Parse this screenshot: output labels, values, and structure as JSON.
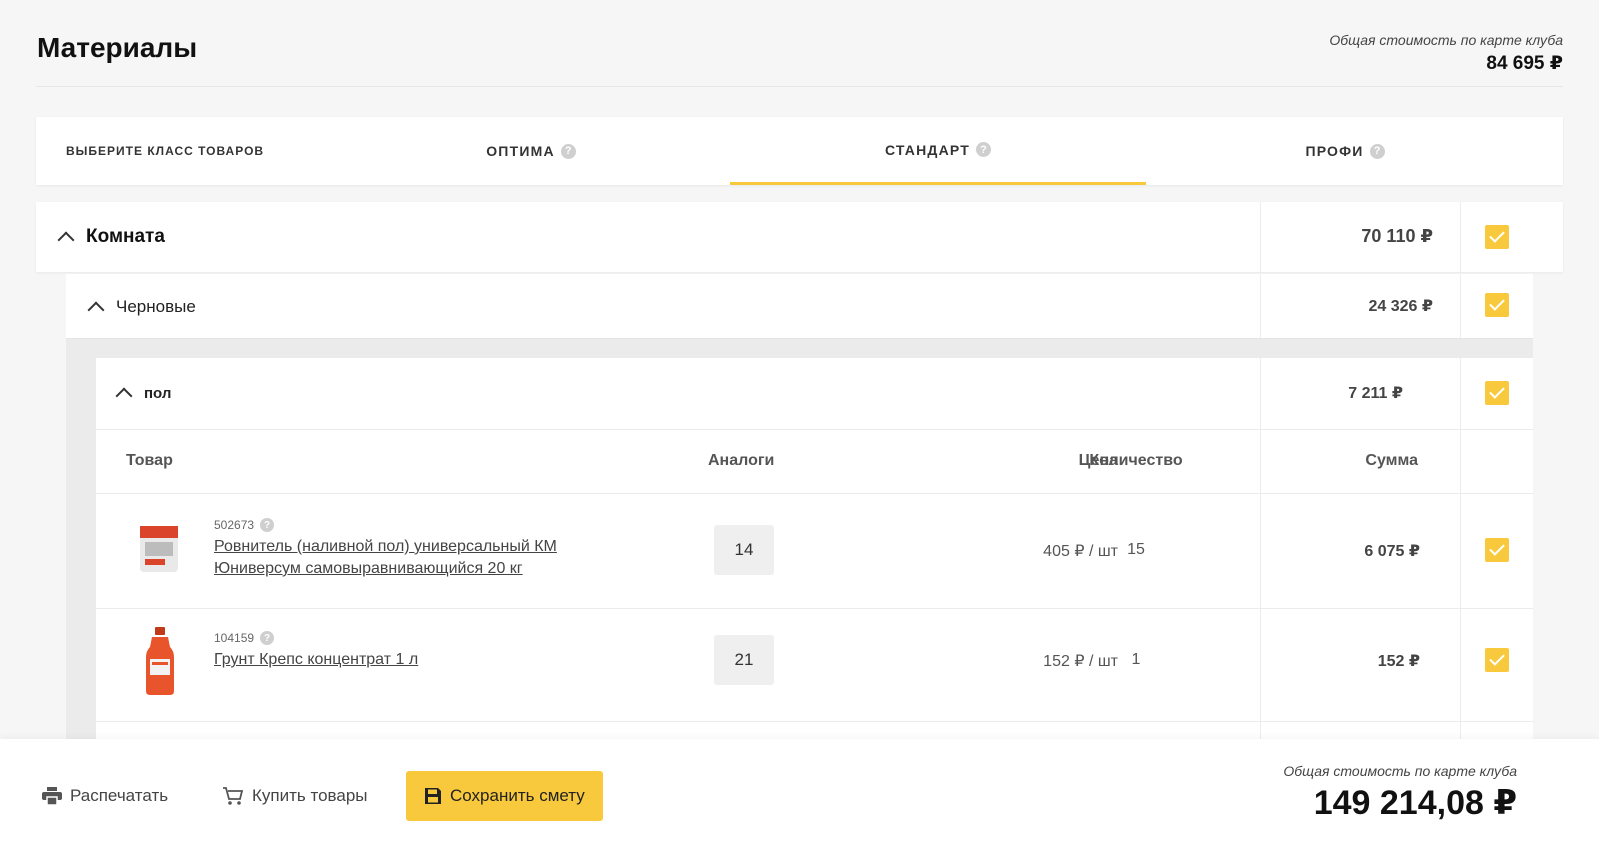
{
  "header": {
    "title": "Материалы",
    "total_label": "Общая стоимость по карте клуба",
    "total_value": "84 695 ₽"
  },
  "classes": {
    "label": "ВЫБЕРИТЕ КЛАСС ТОВАРОВ",
    "tabs": [
      {
        "label": "ОПТИМА",
        "active": false
      },
      {
        "label": "СТАНДАРТ",
        "active": true
      },
      {
        "label": "ПРОФИ",
        "active": false
      }
    ],
    "accent": "#f8c93c"
  },
  "room": {
    "label": "Комната",
    "sum": "70 110 ₽",
    "checked": true
  },
  "subgroup": {
    "label": "Черновые",
    "sum": "24 326 ₽",
    "checked": true
  },
  "section": {
    "label": "пол",
    "sum": "7 211 ₽",
    "checked": true
  },
  "table": {
    "headers": {
      "product": "Товар",
      "analogs": "Аналоги",
      "price": "Цена",
      "qty": "Количество",
      "sum": "Сумма"
    },
    "rows": [
      {
        "sku": "502673",
        "name_line1": "Ровнитель (наливной пол) универсальный КМ",
        "name_line2": "Юниверсум самовыравнивающийся 20 кг",
        "analogs": "14",
        "price": "405 ₽ / шт",
        "qty": "15",
        "sum": "6 075 ₽",
        "checked": true,
        "thumb": "bag-icon"
      },
      {
        "sku": "104159",
        "name_line1": "Грунт Крепс концентрат 1 л",
        "name_line2": "",
        "analogs": "21",
        "price": "152 ₽ / шт",
        "qty": "1",
        "sum": "152 ₽",
        "checked": true,
        "thumb": "bottle-icon"
      }
    ]
  },
  "bottom": {
    "print_label": "Распечатать",
    "buy_label": "Купить товары",
    "save_label": "Сохранить смету",
    "total_label": "Общая стоимость по карте клуба",
    "total_value": "149 214,08 ₽"
  }
}
